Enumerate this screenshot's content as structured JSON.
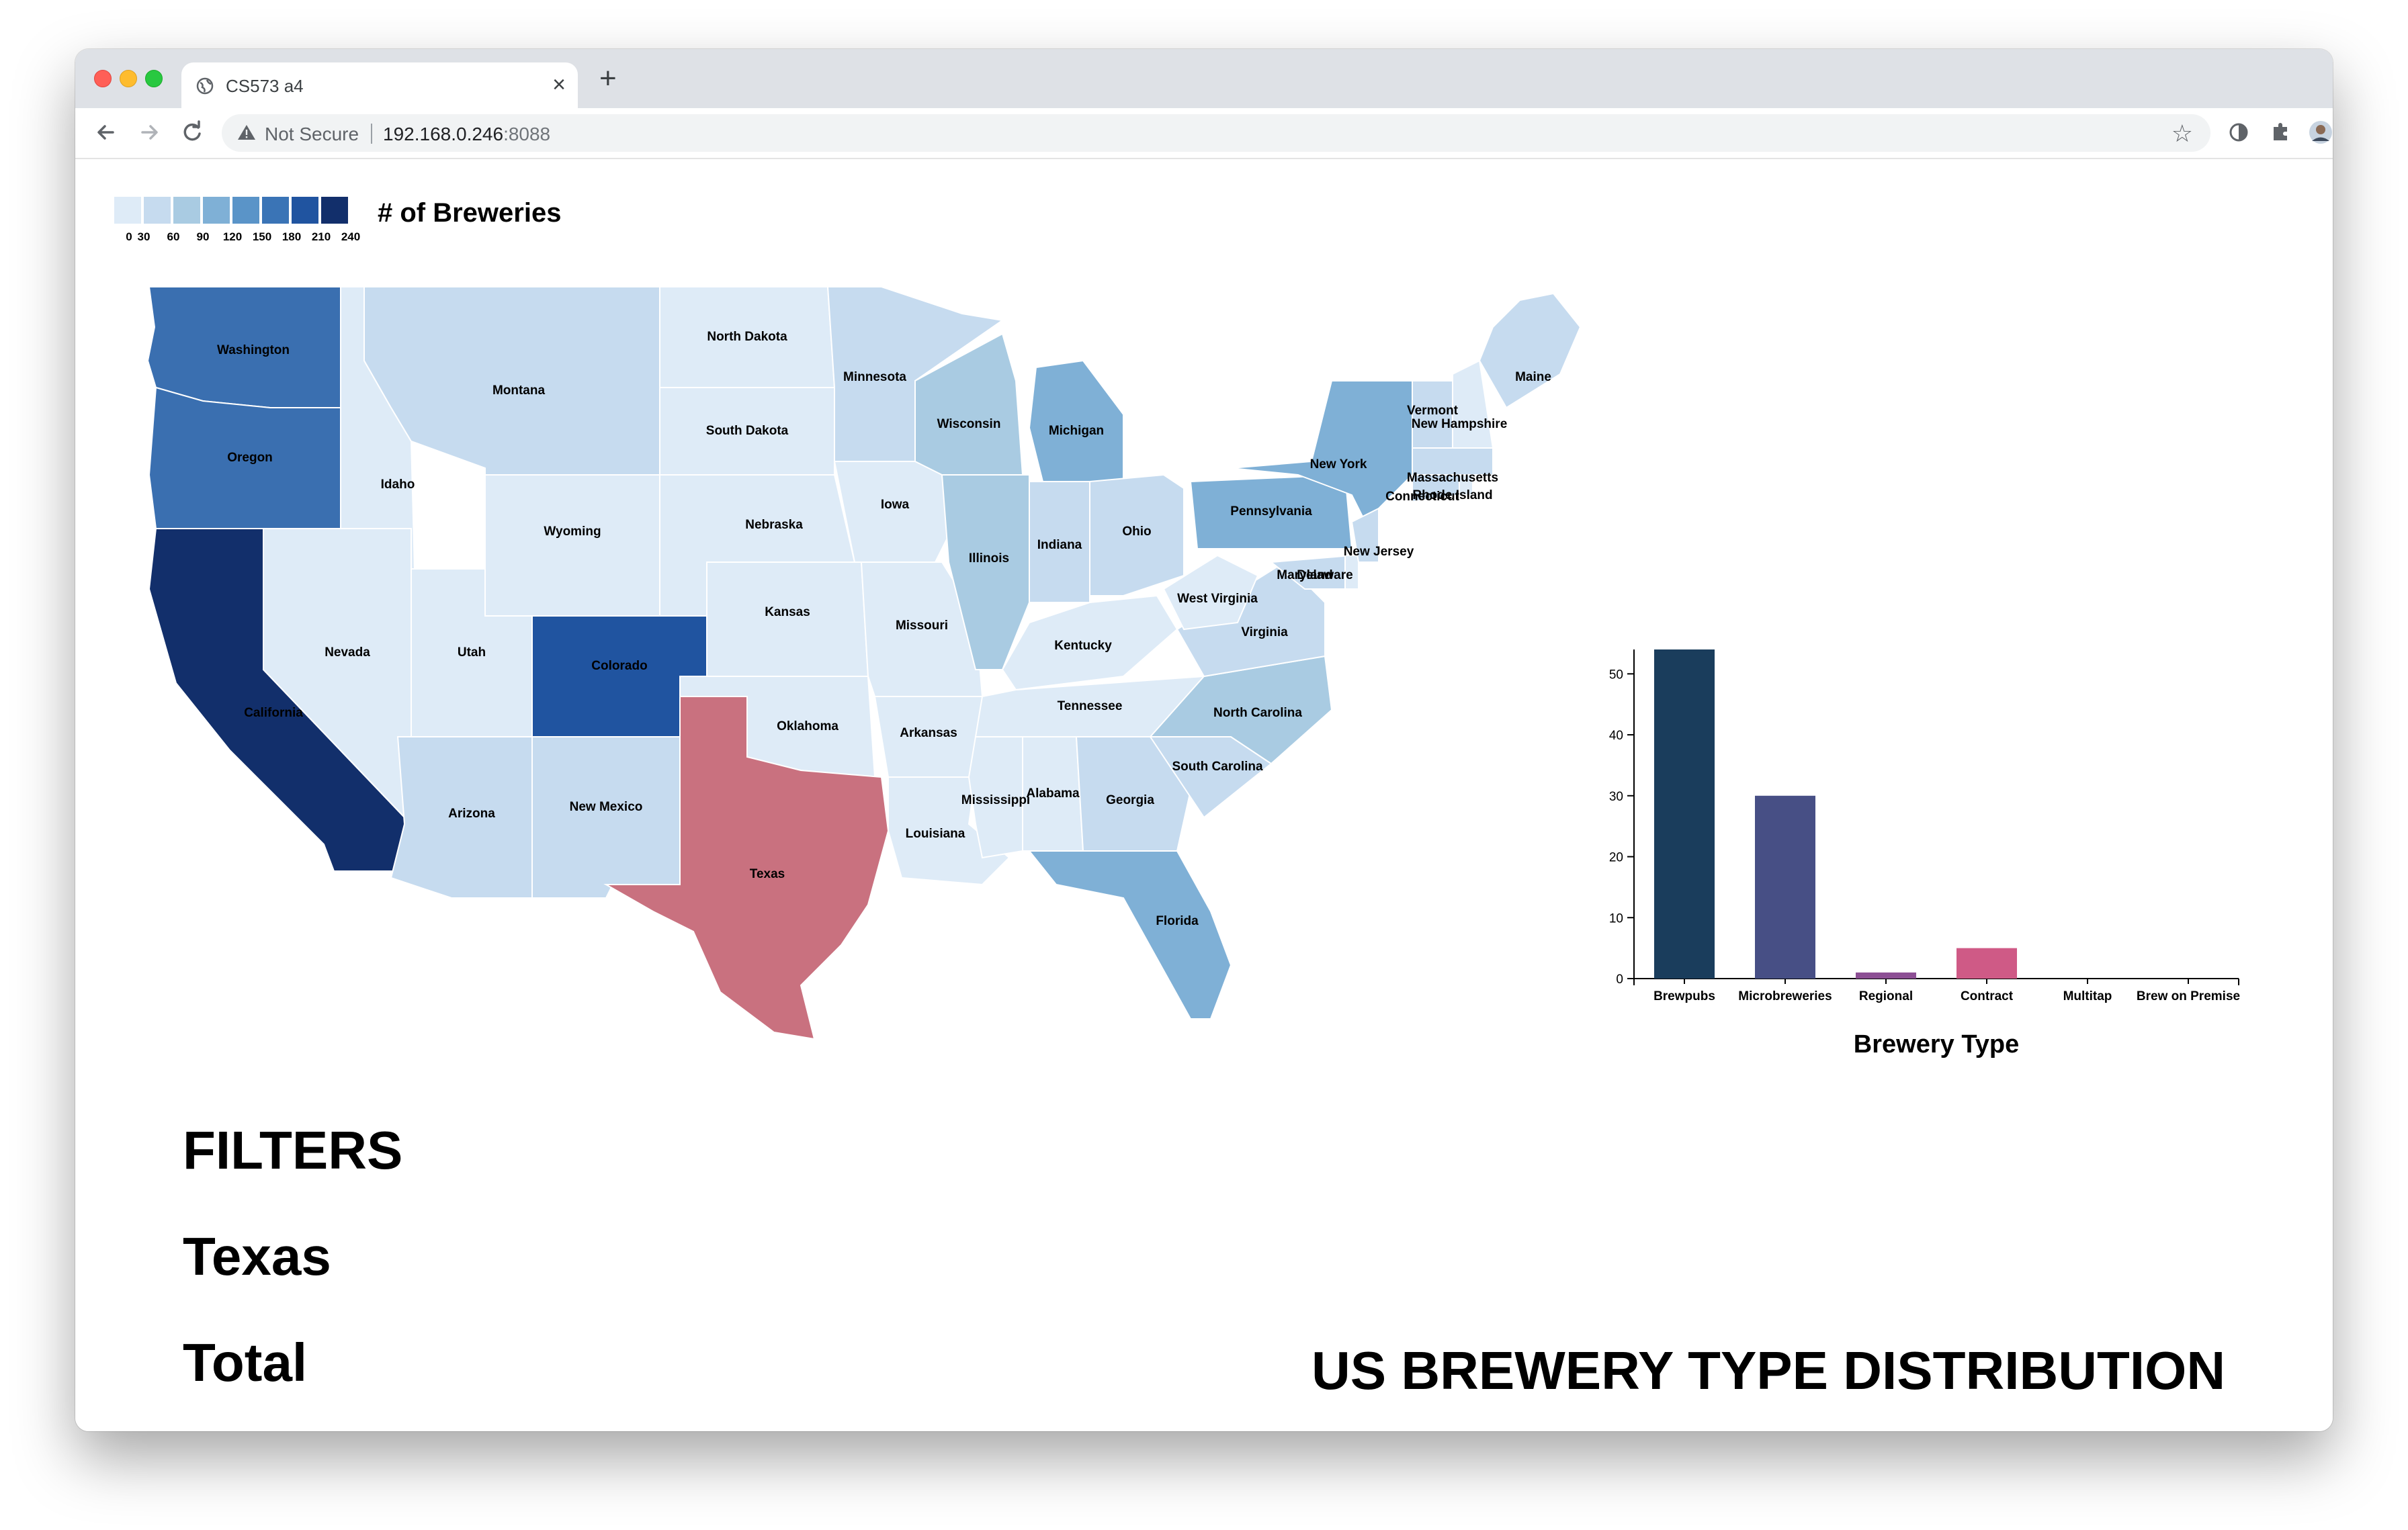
{
  "browser": {
    "tab_title": "CS573 a4",
    "new_tab_symbol": "+",
    "close_symbol": "×",
    "security_text": "Not Secure",
    "url_host": "192.168.0.246",
    "url_port": ":8088"
  },
  "legend": {
    "title": "# of Breweries",
    "ticks": [
      "0",
      "30",
      "60",
      "90",
      "120",
      "150",
      "180",
      "210",
      "240"
    ],
    "colors": [
      "#deebf7",
      "#c6dbef",
      "#a9cbe2",
      "#7fb0d6",
      "#5a94c8",
      "#3a74b6",
      "#2054a0",
      "#122f6b"
    ]
  },
  "map": {
    "selected_state": "Texas",
    "selected_color": "#c9717f",
    "states": [
      {
        "name": "Washington",
        "color": "#3a6fb0"
      },
      {
        "name": "Oregon",
        "color": "#3a6fb0"
      },
      {
        "name": "California",
        "color": "#122f6b"
      },
      {
        "name": "Idaho",
        "color": "#deebf7"
      },
      {
        "name": "Nevada",
        "color": "#deebf7"
      },
      {
        "name": "Montana",
        "color": "#c6dbef"
      },
      {
        "name": "Wyoming",
        "color": "#deebf7"
      },
      {
        "name": "Utah",
        "color": "#deebf7"
      },
      {
        "name": "Arizona",
        "color": "#c6dbef"
      },
      {
        "name": "Colorado",
        "color": "#2054a0"
      },
      {
        "name": "New Mexico",
        "color": "#c6dbef"
      },
      {
        "name": "North Dakota",
        "color": "#deebf7"
      },
      {
        "name": "South Dakota",
        "color": "#deebf7"
      },
      {
        "name": "Nebraska",
        "color": "#deebf7"
      },
      {
        "name": "Kansas",
        "color": "#deebf7"
      },
      {
        "name": "Oklahoma",
        "color": "#deebf7"
      },
      {
        "name": "Texas",
        "color": "#c9717f"
      },
      {
        "name": "Minnesota",
        "color": "#c6dbef"
      },
      {
        "name": "Iowa",
        "color": "#deebf7"
      },
      {
        "name": "Missouri",
        "color": "#deebf7"
      },
      {
        "name": "Arkansas",
        "color": "#deebf7"
      },
      {
        "name": "Louisiana",
        "color": "#deebf7"
      },
      {
        "name": "Wisconsin",
        "color": "#a9cbe2"
      },
      {
        "name": "Illinois",
        "color": "#a9cbe2"
      },
      {
        "name": "Michigan",
        "color": "#7fb0d6"
      },
      {
        "name": "Indiana",
        "color": "#c6dbef"
      },
      {
        "name": "Ohio",
        "color": "#c6dbef"
      },
      {
        "name": "Kentucky",
        "color": "#deebf7"
      },
      {
        "name": "Tennessee",
        "color": "#deebf7"
      },
      {
        "name": "Mississippi",
        "color": "#deebf7"
      },
      {
        "name": "Alabama",
        "color": "#deebf7"
      },
      {
        "name": "Georgia",
        "color": "#c6dbef"
      },
      {
        "name": "Florida",
        "color": "#7fb0d6"
      },
      {
        "name": "South Carolina",
        "color": "#c6dbef"
      },
      {
        "name": "North Carolina",
        "color": "#a9cbe2"
      },
      {
        "name": "Virginia",
        "color": "#c6dbef"
      },
      {
        "name": "West Virginia",
        "color": "#deebf7"
      },
      {
        "name": "Pennsylvania",
        "color": "#7fb0d6"
      },
      {
        "name": "New York",
        "color": "#7fb0d6"
      },
      {
        "name": "Maryland",
        "color": "#c6dbef"
      },
      {
        "name": "Delaware",
        "color": "#deebf7"
      },
      {
        "name": "New Jersey",
        "color": "#c6dbef"
      },
      {
        "name": "Connecticut",
        "color": "#c6dbef"
      },
      {
        "name": "Rhode Island",
        "color": "#deebf7"
      },
      {
        "name": "Massachusetts",
        "color": "#c6dbef"
      },
      {
        "name": "Vermont",
        "color": "#c6dbef"
      },
      {
        "name": "New Hampshire",
        "color": "#deebf7"
      },
      {
        "name": "Maine",
        "color": "#c6dbef"
      }
    ]
  },
  "chart_data": {
    "type": "bar",
    "categories": [
      "Brewpubs",
      "Microbreweries",
      "Regional",
      "Contract",
      "Multitap",
      "Brew on Premise"
    ],
    "values": [
      54,
      30,
      1,
      5,
      0,
      0
    ],
    "colors": [
      "#1a3d5c",
      "#474f85",
      "#8c4f94",
      "#cf5a86",
      "#e0607a",
      "#e8735e"
    ],
    "xlabel": "Brewery Type",
    "ylabel": "",
    "ylim": [
      0,
      54
    ],
    "yticks": [
      0,
      10,
      20,
      30,
      40,
      50
    ],
    "grid": false
  },
  "filters": {
    "heading": "FILTERS",
    "state": "Texas",
    "total_label": "Total"
  },
  "page_title": "US BREWERY TYPE DISTRIBUTION"
}
